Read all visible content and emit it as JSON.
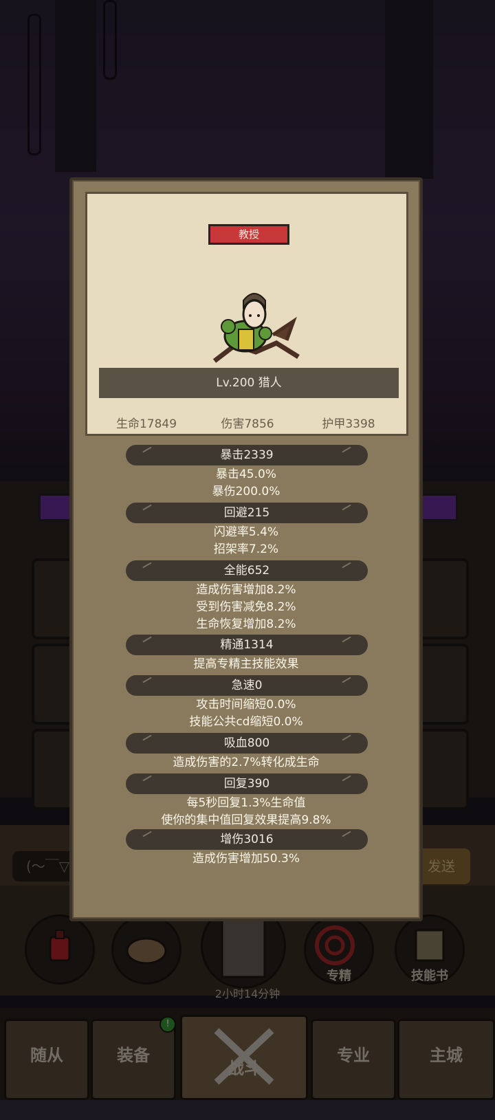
{
  "profile": {
    "title_badge": "教授",
    "level_text": "Lv.200 猎人",
    "base_stats": {
      "hp": "生命17849",
      "damage": "伤害7856",
      "armor": "护甲3398"
    }
  },
  "stats": {
    "crit": {
      "header": "暴击2339",
      "lines": [
        "暴击45.0%",
        "暴伤200.0%"
      ]
    },
    "dodge": {
      "header": "回避215",
      "lines": [
        "闪避率5.4%",
        "招架率7.2%"
      ]
    },
    "versatility": {
      "header": "全能652",
      "lines": [
        "造成伤害增加8.2%",
        "受到伤害减免8.2%",
        "生命恢复增加8.2%"
      ]
    },
    "mastery": {
      "header": "精通1314",
      "lines": [
        "提高专精主技能效果"
      ]
    },
    "haste": {
      "header": "急速0",
      "lines": [
        "攻击时间缩短0.0%",
        "技能公共cd缩短0.0%"
      ]
    },
    "leech": {
      "header": "吸血800",
      "lines": [
        "造成伤害的2.7%转化成生命"
      ]
    },
    "regen": {
      "header": "回复390",
      "lines": [
        "每5秒回复1.3%生命值",
        "使你的集中值回复效果提高9.8%"
      ]
    },
    "dmg_bonus": {
      "header": "增伤3016",
      "lines": [
        "造成伤害增加50.3%"
      ]
    }
  },
  "background": {
    "chat_input": "(～￣▽",
    "send_button": "发送",
    "timer": "2小时14分钟",
    "skills": {
      "mastery": "专精",
      "skill_book": "技能书"
    },
    "tabs": [
      "随从",
      "装备",
      "战斗",
      "专业",
      "主城"
    ],
    "equipment_badge": "!"
  },
  "colors": {
    "popup_bg": "#8a7a5d",
    "card_bg": "#e7dcc0",
    "badge_red": "#c6383a",
    "stat_header_bg": "#3e3830"
  }
}
